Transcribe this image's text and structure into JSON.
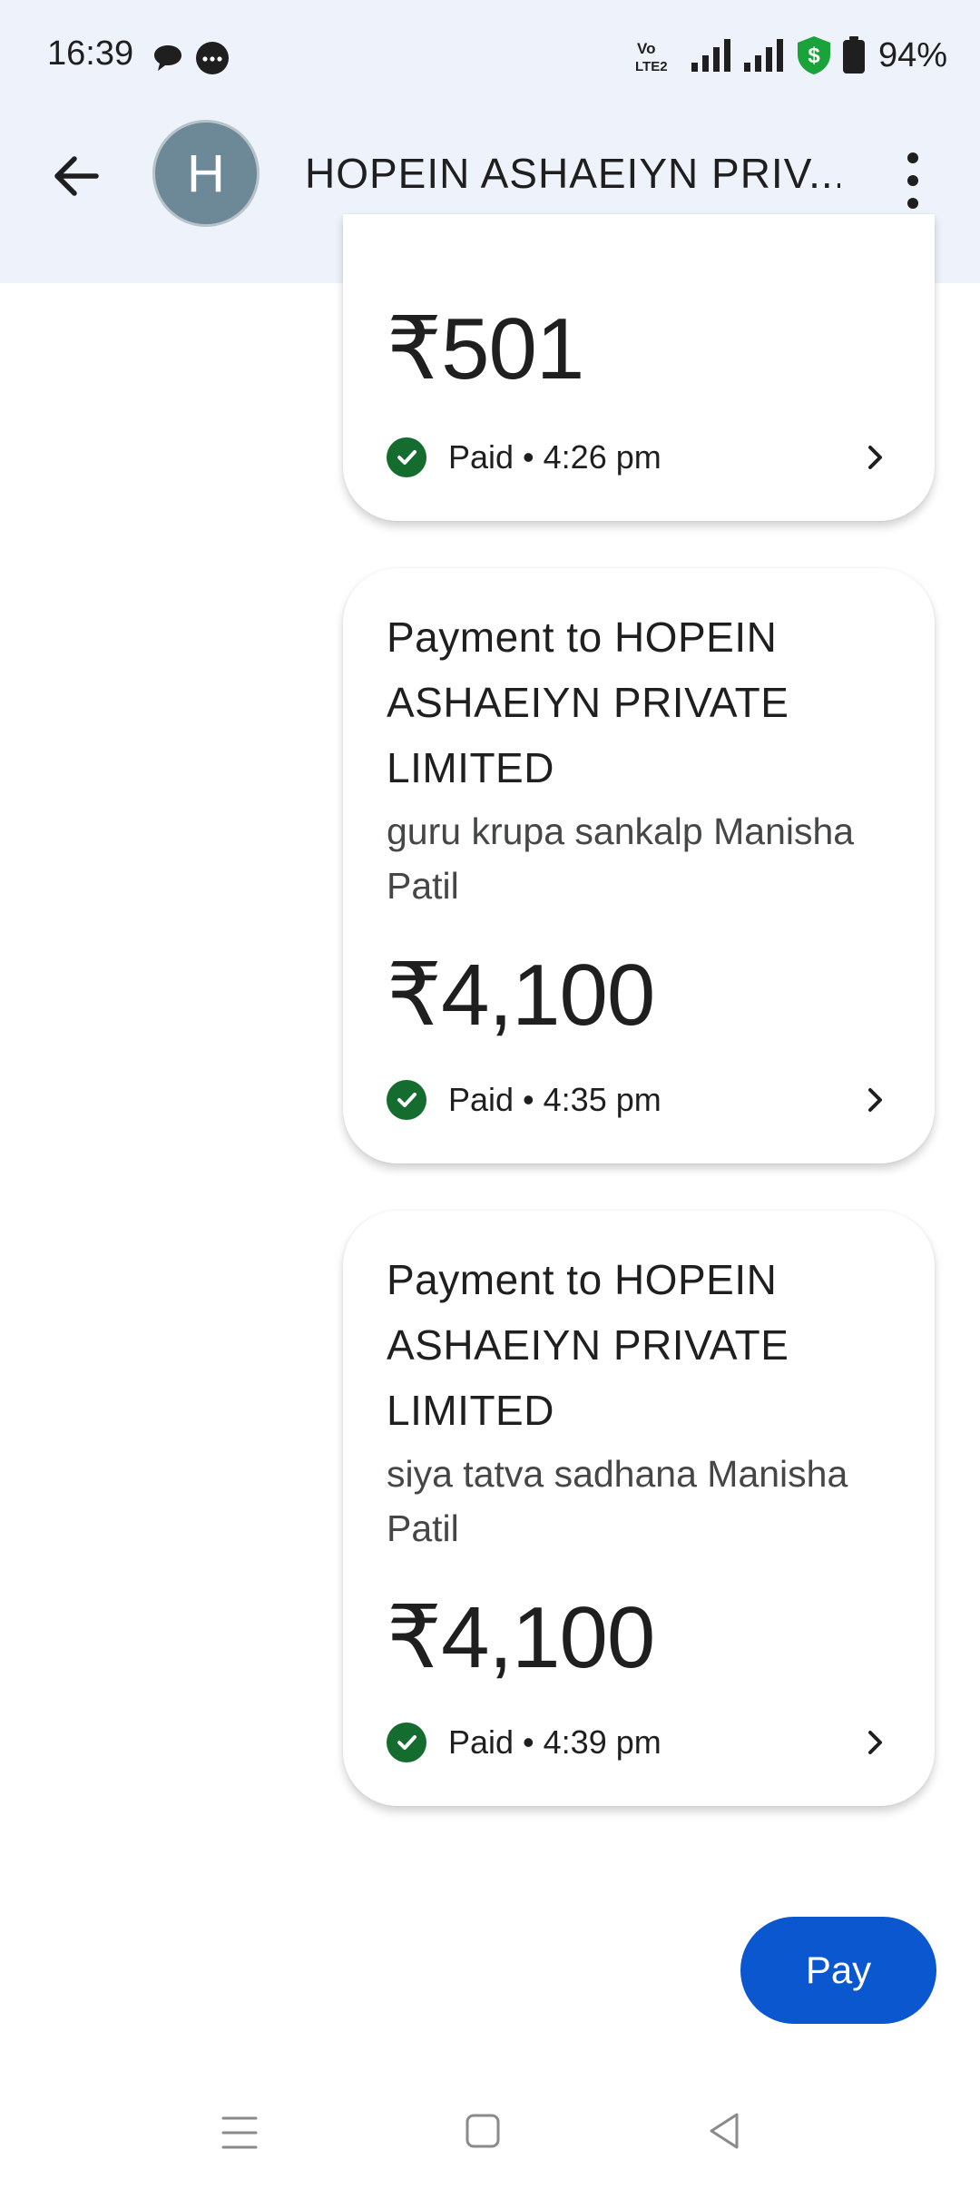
{
  "status_bar": {
    "time": "16:39",
    "icons": [
      "chat-bubble-icon",
      "message-dots-icon",
      "volte-icon",
      "signal-icon",
      "signal-icon",
      "security-shield-dollar-icon",
      "battery-icon"
    ],
    "battery": "94%"
  },
  "header": {
    "avatar_letter": "H",
    "title": "HOPEIN ASHAEIYN PRIV...",
    "colors": {
      "header_bg": "#eef2fa",
      "avatar_bg": "#6d8896"
    }
  },
  "transactions": [
    {
      "title": "",
      "note": "",
      "amount": "₹501",
      "status": "Paid • 4:26 pm"
    },
    {
      "title": "Payment to HOPEIN ASHAEIYN PRIVATE LIMITED",
      "note": "guru krupa sankalp Manisha Patil",
      "amount": "₹4,100",
      "status": "Paid • 4:35 pm"
    },
    {
      "title": "Payment to HOPEIN ASHAEIYN PRIVATE LIMITED",
      "note": "siya tatva sadhana Manisha Patil",
      "amount": "₹4,100",
      "status": "Paid • 4:39 pm"
    }
  ],
  "pay_button": {
    "label": "Pay",
    "color": "#0b57d0"
  },
  "status_color": "#146c2e",
  "nav_bar": {
    "icons": [
      "menu-icon",
      "home-square-icon",
      "back-triangle-icon"
    ]
  }
}
